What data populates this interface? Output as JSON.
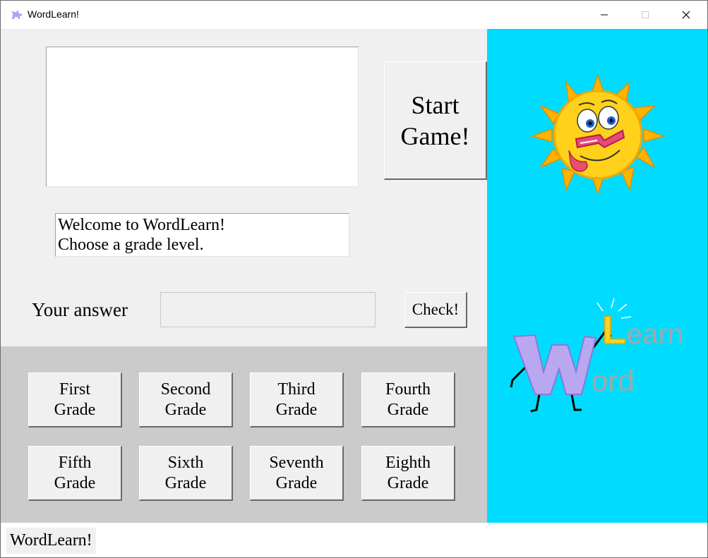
{
  "window": {
    "title": "WordLearn!",
    "minimize_glyph": "—",
    "maximize_glyph": "☐",
    "close_glyph": "✕"
  },
  "game": {
    "word_display": "",
    "start_line1": "Start",
    "start_line2": "Game!",
    "message_line1": "Welcome to WordLearn!",
    "message_line2": "Choose a grade level.",
    "answer_label": "Your answer",
    "answer_value": "",
    "check_label": "Check!"
  },
  "grades": [
    {
      "line1": "First",
      "line2": "Grade"
    },
    {
      "line1": "Second",
      "line2": "Grade"
    },
    {
      "line1": "Third",
      "line2": "Grade"
    },
    {
      "line1": "Fourth",
      "line2": "Grade"
    },
    {
      "line1": "Fifth",
      "line2": "Grade"
    },
    {
      "line1": "Sixth",
      "line2": "Grade"
    },
    {
      "line1": "Seventh",
      "line2": "Grade"
    },
    {
      "line1": "Eighth",
      "line2": "Grade"
    }
  ],
  "logo": {
    "letter_w": "W",
    "letter_l": "L",
    "text_earn": "earn",
    "text_ord": "ord"
  },
  "status": {
    "label": "WordLearn!"
  },
  "colors": {
    "panel": "#f0f0f0",
    "grade_panel": "#cbcbcb",
    "side_panel": "#00dcff",
    "logo_w": "#b9a8f0",
    "logo_l": "#ffd21e",
    "logo_text": "#a6a6a6"
  },
  "icons": {
    "app": "cat-icon",
    "sun": "sun-mascot-icon",
    "logo": "wordlearn-logo-icon"
  }
}
